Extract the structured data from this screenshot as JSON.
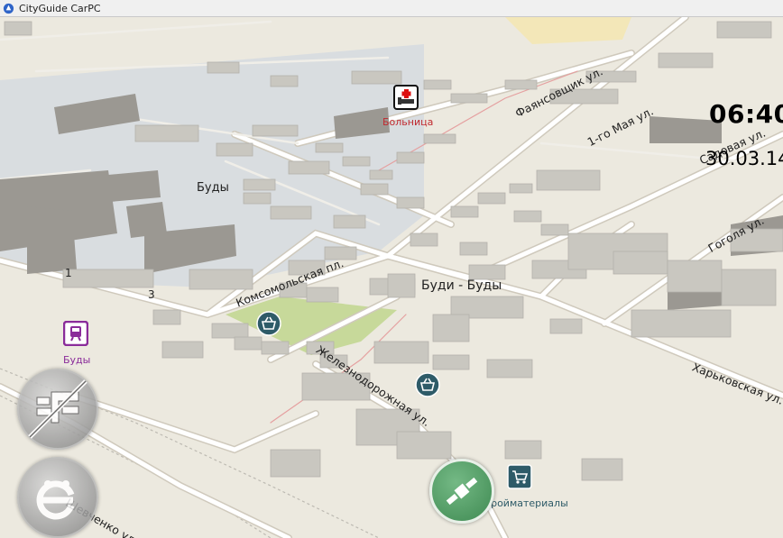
{
  "window": {
    "title": "CityGuide CarPC"
  },
  "clock": {
    "time": "06:40",
    "date": "30.03.14"
  },
  "streets": {
    "fayansovshik": "Фаянсовщик ул.",
    "may1": "1-го Мая ул.",
    "sadovaya": "Садовая ул.",
    "gogolya": "Гоголя ул.",
    "komsomolskaya": "Комсомольская пл.",
    "zheleznodorozhnaya": "Железнодорожная ул.",
    "kharkovskaya": "Харьковская ул.",
    "shevchenko": "Шевченко ул."
  },
  "places": {
    "budy": "Буды",
    "budi_budy": "Буди - Буды",
    "number_1": "1",
    "number_3": "3"
  },
  "pois": {
    "hospital": "Больница",
    "station": "Буды",
    "building_materials": "Стройматериалы"
  },
  "colors": {
    "map_bg": "#ece9df",
    "industrial": "#d9dde0",
    "park": "#c7d99a",
    "sand": "#f3e7b8",
    "road": "#ffffff",
    "road_casing": "#c9c3b6",
    "rail": "#e8a7a7",
    "building_top": "#c9c7c0",
    "building_side": "#9b9892",
    "poi_shop": "#2e5b68",
    "poi_station": "#8a2c9a",
    "nav_button": "#4c9a5c"
  },
  "icons": {
    "hospital": "hospital-icon",
    "station": "railway-station-icon",
    "shop": "shopping-basket-icon",
    "building_materials": "shopping-cart-icon",
    "compass": "satellite-icon",
    "nav_map": "map-mode-icon",
    "nav_menu": "menu-icon"
  }
}
